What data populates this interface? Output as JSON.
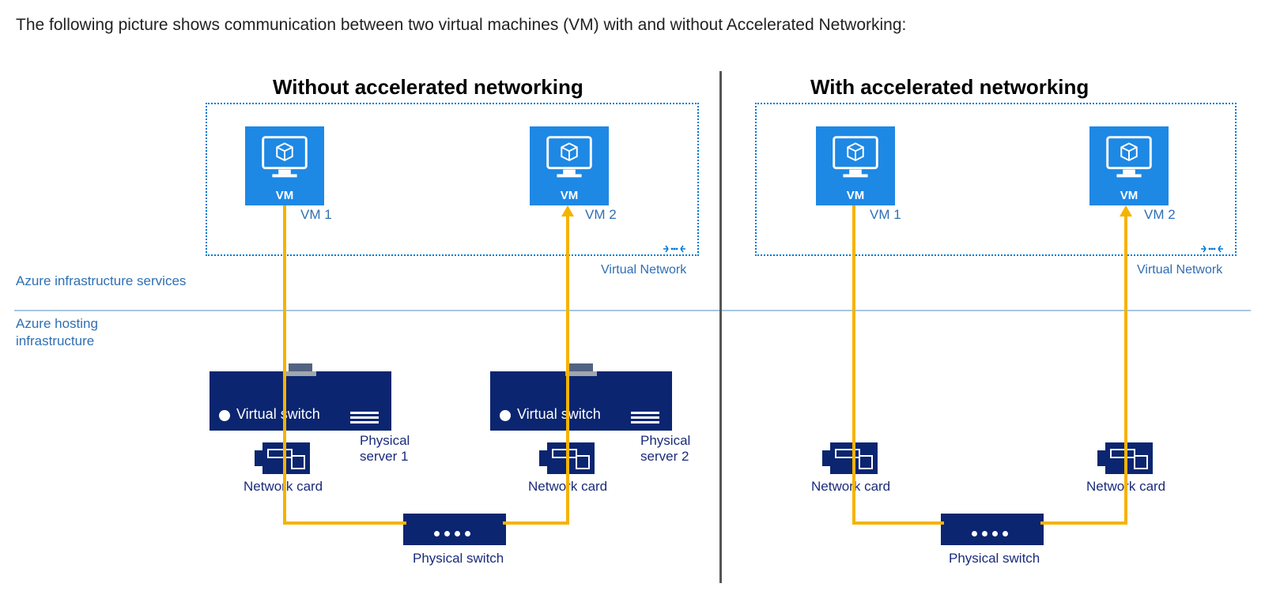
{
  "intro": "The following picture shows communication between two virtual machines (VM) with and without Accelerated Networking:",
  "layers": {
    "top_region": "Azure infrastructure services",
    "bottom_region": "Azure hosting infrastructure"
  },
  "left": {
    "title": "Without accelerated networking",
    "vnet_label": "Virtual Network",
    "vm1": {
      "icon_label": "VM",
      "caption": "VM 1"
    },
    "vm2": {
      "icon_label": "VM",
      "caption": "VM 2"
    },
    "vswitch1": {
      "label": "Virtual switch",
      "server_label": "Physical server 1"
    },
    "vswitch2": {
      "label": "Virtual switch",
      "server_label": "Physical server 2"
    },
    "nic1_label": "Network card",
    "nic2_label": "Network card",
    "pswitch_label": "Physical switch"
  },
  "right": {
    "title": "With accelerated networking",
    "vnet_label": "Virtual Network",
    "vm1": {
      "icon_label": "VM",
      "caption": "VM 1"
    },
    "vm2": {
      "icon_label": "VM",
      "caption": "VM 2"
    },
    "nic1_label": "Network card",
    "nic2_label": "Network card",
    "pswitch_label": "Physical switch"
  },
  "colors": {
    "vm_fill": "#1e88e5",
    "server_fill": "#0b2570",
    "connector": "#f5b301",
    "vnet_dash": "#0078d4",
    "blue_text": "#2f6fb3",
    "darkblue_text": "#1a2b7b"
  }
}
